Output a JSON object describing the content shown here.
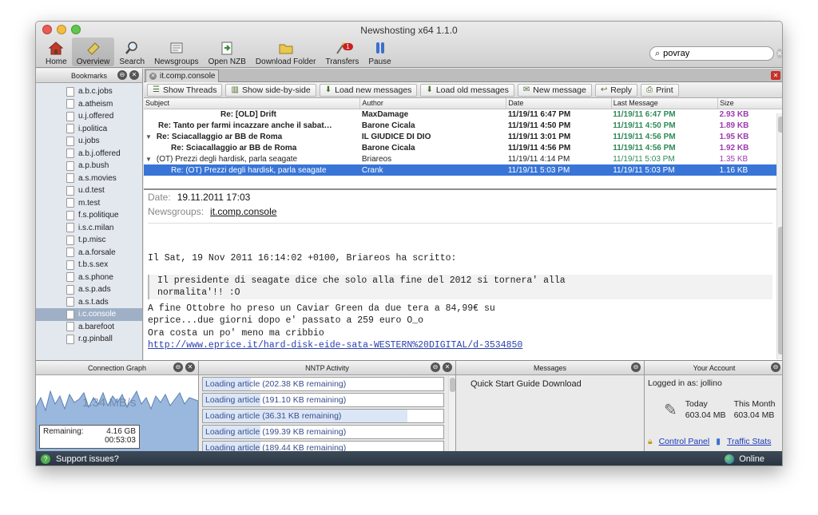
{
  "window": {
    "title": "Newshosting x64 1.1.0"
  },
  "toolbar": {
    "items": [
      {
        "label": "Home",
        "icon": "home-icon"
      },
      {
        "label": "Overview",
        "icon": "overview-icon"
      },
      {
        "label": "Search",
        "icon": "search-icon"
      },
      {
        "label": "Newsgroups",
        "icon": "newsgroups-icon"
      },
      {
        "label": "Open NZB",
        "icon": "open-nzb-icon"
      },
      {
        "label": "Download Folder",
        "icon": "folder-icon"
      },
      {
        "label": "Transfers",
        "icon": "transfers-icon",
        "badge": "1"
      },
      {
        "label": "Pause",
        "icon": "pause-icon"
      }
    ],
    "search_value": "povray"
  },
  "bookmarks": {
    "title": "Bookmarks",
    "items": [
      "a.b.c.jobs",
      "a.atheism",
      "u.j.offered",
      "i.politica",
      "u.jobs",
      "a.b.j.offered",
      "a.p.bush",
      "a.s.movies",
      "u.d.test",
      "m.test",
      "f.s.politique",
      "i.s.c.milan",
      "t.p.misc",
      "a.a.forsale",
      "t.b.s.sex",
      "a.s.phone",
      "a.s.p.ads",
      "a.s.t.ads",
      "i.c.console",
      "a.barefoot",
      "r.g.pinball"
    ],
    "selected": "i.c.console"
  },
  "tab": {
    "label": "it.comp.console"
  },
  "actions": {
    "show_threads": "Show Threads",
    "show_side": "Show side-by-side",
    "load_new": "Load new messages",
    "load_old": "Load old messages",
    "new_message": "New message",
    "reply": "Reply",
    "print": "Print"
  },
  "table": {
    "headers": {
      "subject": "Subject",
      "author": "Author",
      "date": "Date",
      "last": "Last Message",
      "size": "Size"
    },
    "rows": [
      {
        "subject": "Re: [OLD] Drift",
        "author": "MaxDamage",
        "date": "11/19/11 6:47 PM",
        "last": "11/19/11 6:47 PM",
        "size": "2.93 KB"
      },
      {
        "subject": "Re: Tanto per farmi incazzare anche il sabat…",
        "author": "Barone Cicala",
        "date": "11/19/11 4:50 PM",
        "last": "11/19/11 4:50 PM",
        "size": "1.89 KB"
      },
      {
        "subject": "Re: Sciacallaggio ar BB de Roma",
        "author": "IL GIUDICE DI DIO",
        "date": "11/19/11 3:01 PM",
        "last": "11/19/11 4:56 PM",
        "size": "1.95 KB"
      },
      {
        "subject": "Re: Sciacallaggio ar BB de Roma",
        "author": "Barone Cicala",
        "date": "11/19/11 4:56 PM",
        "last": "11/19/11 4:56 PM",
        "size": "1.92 KB"
      },
      {
        "subject": "(OT) Prezzi degli hardisk, parla seagate",
        "author": "Briareos",
        "date": "11/19/11 4:14 PM",
        "last": "11/19/11 5:03 PM",
        "size": "1.35 KB"
      },
      {
        "subject": "Re: (OT) Prezzi degli hardisk, parla seagate",
        "author": "Crank",
        "date": "11/19/11 5:03 PM",
        "last": "11/19/11 5:03 PM",
        "size": "1.16 KB"
      }
    ]
  },
  "message": {
    "date_label": "Date:",
    "date_value": "19.11.2011 17:03",
    "groups_label": "Newsgroups:",
    "groups_value": "it.comp.console",
    "intro": "Il Sat, 19 Nov 2011 16:14:02 +0100, Briareos ha scritto:",
    "quote1": "Il presidente di seagate dice che solo alla fine del 2012 si tornera' alla",
    "quote2": "normalita'!! :O",
    "line1": "A fine Ottobre ho preso un Caviar Green da due tera a 84,99€ su",
    "line2": "eprice...due giorni dopo e' passato a 259 euro O_o",
    "line3": "Ora costa un po' meno ma cribbio",
    "link": "http://www.eprice.it/hard-disk-eide-sata-WESTERN%20DIGITAL/d-3534850"
  },
  "connection": {
    "title": "Connection Graph",
    "rate": "1.34 MB/s",
    "remaining_label": "Remaining:",
    "remaining_size": "4.16 GB",
    "remaining_time": "00:53:03"
  },
  "nntp": {
    "title": "NNTP Activity",
    "rows": [
      {
        "text": "Loading article (202.38 KB remaining)",
        "progress": 0.2
      },
      {
        "text": "Loading article (191.10 KB remaining)",
        "progress": 0.24
      },
      {
        "text": "Loading article (36.31 KB remaining)",
        "progress": 0.85
      },
      {
        "text": "Loading article (199.39 KB remaining)",
        "progress": 0.24
      },
      {
        "text": "Loading article (189.44 KB remaining)",
        "progress": 0.24
      }
    ]
  },
  "messages_panel": {
    "title": "Messages",
    "text": "Quick Start Guide Download"
  },
  "account": {
    "title": "Your Account",
    "logged_in": "Logged in as: jollino",
    "today_label": "Today",
    "today_value": "603.04 MB",
    "month_label": "This Month",
    "month_value": "603.04 MB",
    "control_panel": "Control Panel",
    "traffic_stats": "Traffic Stats"
  },
  "status": {
    "support": "Support issues?",
    "online": "Online"
  }
}
